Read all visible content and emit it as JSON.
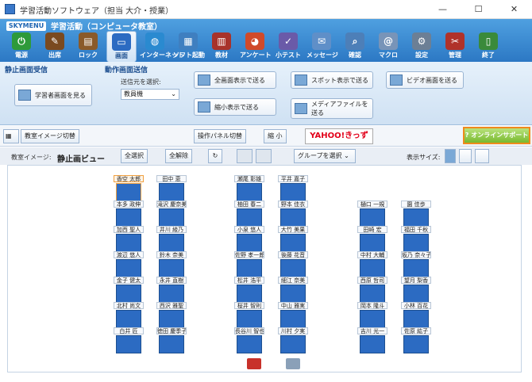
{
  "window": {
    "title": "学習活動ソフトウェア（担当 大介・授業）",
    "min": "—",
    "max": "☐",
    "close": "✕"
  },
  "app": {
    "logo": "SKYMENU",
    "title": "学習活動（コンピュータ教室）"
  },
  "toolbar": [
    {
      "label": "電源",
      "icon": "power-icon",
      "color": "#2e9a3a",
      "glyph": "⏻"
    },
    {
      "label": "出席",
      "icon": "attendance-icon",
      "color": "#7a4a1f",
      "glyph": "✎"
    },
    {
      "label": "ロック",
      "icon": "lock-icon",
      "color": "#8a5a2a",
      "glyph": "▤"
    },
    {
      "label": "画面",
      "icon": "monitor-icon",
      "color": "#2c6bc2",
      "glyph": "▭"
    },
    {
      "label": "インターネット",
      "icon": "internet-icon",
      "color": "#2a8ad0",
      "glyph": "◍"
    },
    {
      "label": "ソフト起動",
      "icon": "software-icon",
      "color": "#3f7fc0",
      "glyph": "▦"
    },
    {
      "label": "教材",
      "icon": "books-icon",
      "color": "#a8322a",
      "glyph": "▥"
    },
    {
      "label": "アンケート",
      "icon": "survey-icon",
      "color": "#d04a2a",
      "glyph": "◕"
    },
    {
      "label": "小テスト",
      "icon": "quiz-icon",
      "color": "#6a5aa8",
      "glyph": "✓"
    },
    {
      "label": "メッセージ",
      "icon": "message-icon",
      "color": "#5f8fc8",
      "glyph": "✉"
    },
    {
      "label": "確認",
      "icon": "check-icon",
      "color": "#4d7fb8",
      "glyph": "⌕"
    },
    {
      "label": "マクロ",
      "icon": "macro-icon",
      "color": "#7894b8",
      "glyph": "@"
    },
    {
      "label": "設定",
      "icon": "settings-icon",
      "color": "#6c7f95",
      "glyph": "⚙"
    },
    {
      "label": "管理",
      "icon": "admin-icon",
      "color": "#b0322a",
      "glyph": "✂"
    },
    {
      "label": "終了",
      "icon": "exit-icon",
      "color": "#3a8a3a",
      "glyph": "▯"
    }
  ],
  "ribbon": {
    "grp1": "静止画面受信",
    "btn_view_student": "学習者画面を見る",
    "grp2": "動作画面送信",
    "source_label": "送信元を選択:",
    "source_value": "教員機",
    "btn_full": "全画面表示で送る",
    "btn_shrink": "縮小表示で送る",
    "btn_spot": "スポット表示で送る",
    "btn_media": "メディアファイルを送る",
    "btn_video": "ビデオ画面を送る"
  },
  "bar2": {
    "classroom_image_switch": "教室イメージ切替",
    "panel_switch": "操作パネル切替",
    "shrink": "縮 小",
    "yahoo": "YAHOO!きっず",
    "support": "? オンラインサポート"
  },
  "view": {
    "classroom_label": "教室イメージ:",
    "view_title": "静止画ビュー",
    "select_all": "全選択",
    "deselect_all": "全解除",
    "group_select": "グループを選択",
    "display_size": "表示サイズ:"
  },
  "seats": [
    {
      "name": "香空 太郎",
      "hl": true
    },
    {
      "name": "本多 政伸"
    },
    {
      "name": "加西 聖人"
    },
    {
      "name": "渡辺 悠人"
    },
    {
      "name": "金子 健太"
    },
    {
      "name": "北村 尚文"
    },
    {
      "name": "白井 匠"
    },
    {
      "name": "田中 恵"
    },
    {
      "name": "滝沢 慶奈美"
    },
    {
      "name": "井川 綾乃"
    },
    {
      "name": "鈴木 奈美"
    },
    {
      "name": "永井 直樹"
    },
    {
      "name": "西沢 雅聖"
    },
    {
      "name": "徳田 慶季子"
    },
    {
      "name": "瀬尾 彰雄"
    },
    {
      "name": "柚田 春二"
    },
    {
      "name": "小泉 悠人"
    },
    {
      "name": "佐野 孝一郎"
    },
    {
      "name": "松井 浩平"
    },
    {
      "name": "桜井 智則"
    },
    {
      "name": "長谷川 智也"
    },
    {
      "name": "平井 嘉子"
    },
    {
      "name": "野本 佳衣"
    },
    {
      "name": "大竹 美果"
    },
    {
      "name": "後藤 花音"
    },
    {
      "name": "細江 奈美"
    },
    {
      "name": "中山 雅実"
    },
    {
      "name": "川村 夕実"
    },
    {
      "name": "樋口 一規"
    },
    {
      "name": "田崎 宏"
    },
    {
      "name": "中村 大輔"
    },
    {
      "name": "西原 哲司"
    },
    {
      "name": "岡本 隆斗"
    },
    {
      "name": "吉川 光一"
    },
    {
      "name": "園 佳歩"
    },
    {
      "name": "福田 千秋"
    },
    {
      "name": "坂乃 奈々子"
    },
    {
      "name": "望月 梨香"
    },
    {
      "name": "小林 百花"
    },
    {
      "name": "佐原 紘子"
    }
  ]
}
